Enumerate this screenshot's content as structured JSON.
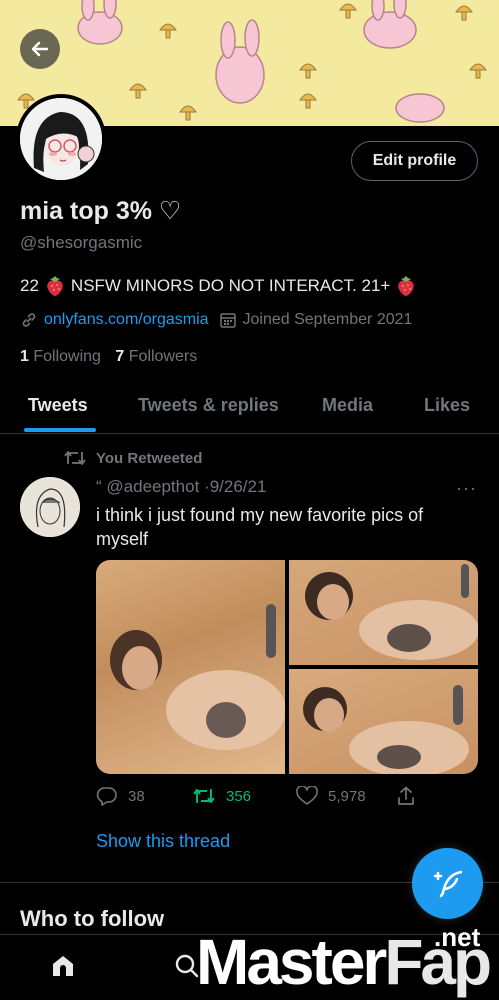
{
  "profile": {
    "display_name": "mia top 3% ♡",
    "handle": "@shesorgasmic",
    "bio_prefix": "22",
    "bio_main": "NSFW MINORS DO NOT INTERACT. 21+",
    "website": "onlyfans.com/orgasmia",
    "joined": "Joined September 2021",
    "following_count": "1",
    "following_label": "Following",
    "followers_count": "7",
    "followers_label": "Followers",
    "edit_profile_label": "Edit profile"
  },
  "tabs": [
    {
      "label": "Tweets",
      "active": true
    },
    {
      "label": "Tweets & replies",
      "active": false
    },
    {
      "label": "Media",
      "active": false
    },
    {
      "label": "Likes",
      "active": false
    }
  ],
  "tweet": {
    "retweet_context": "You Retweeted",
    "author_handle": "@adeepthot",
    "date": "9/26/21",
    "quote_mark": "“",
    "separator": "·",
    "more": "···",
    "text": "i think i just found my new favorite pics of myself",
    "replies": "38",
    "retweets": "356",
    "likes": "5,978",
    "show_thread": "Show this thread"
  },
  "who_to_follow": "Who to follow",
  "watermark": {
    "master": "Master",
    "fap": "Fap",
    "net": ".net"
  },
  "colors": {
    "background": "#000000",
    "accent": "#1d9bf0",
    "retweet_green": "#00ba7c",
    "muted": "#71767b",
    "text": "#e7e9ea",
    "banner": "#f3ea9f"
  },
  "icons": [
    "back-arrow-icon",
    "calendar-icon",
    "link-icon",
    "retweet-icon",
    "reply-icon",
    "like-icon",
    "share-icon",
    "compose-icon",
    "home-icon",
    "search-icon",
    "strawberry-icon"
  ]
}
